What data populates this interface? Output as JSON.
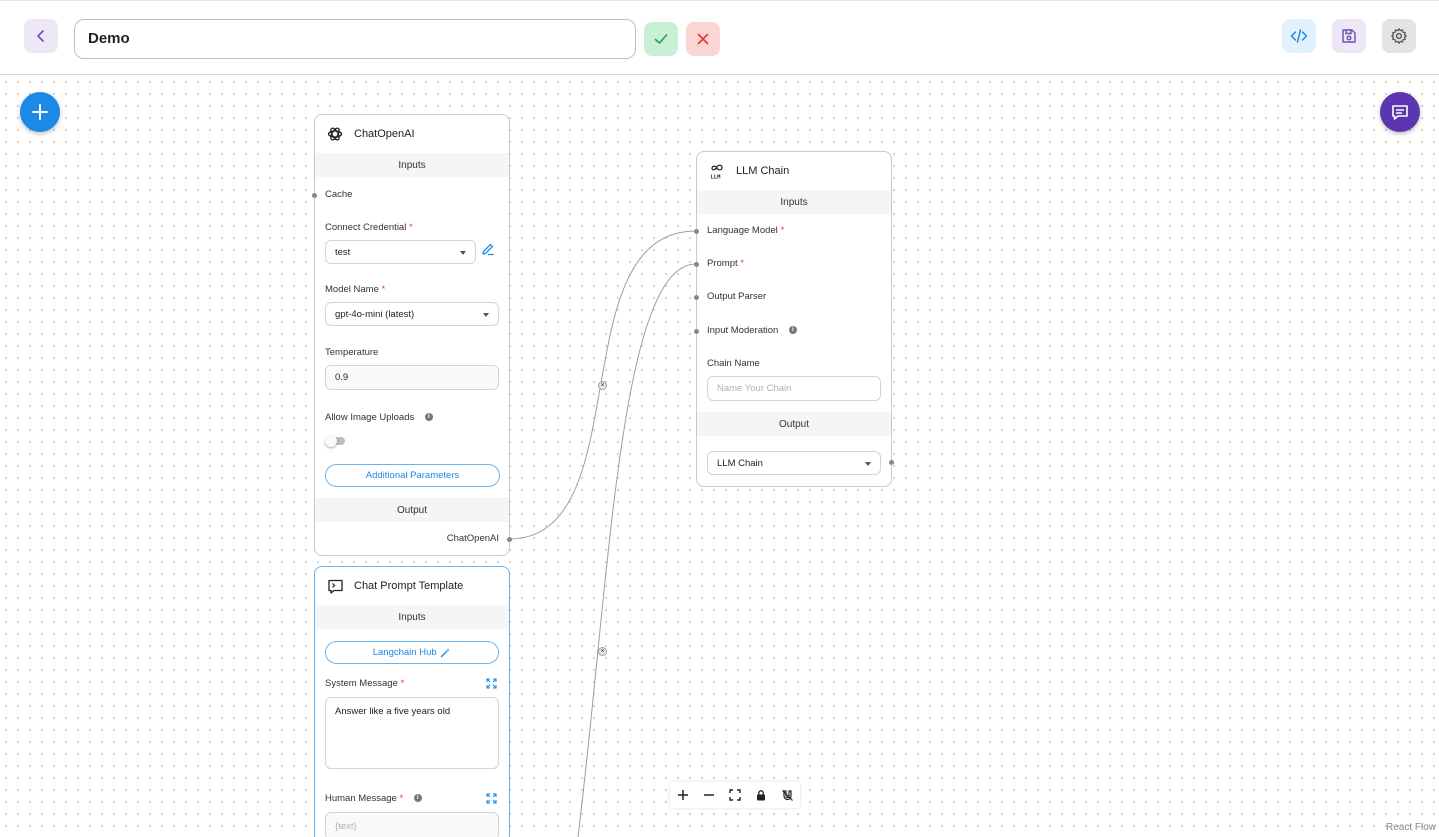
{
  "header": {
    "flow_name": "Demo"
  },
  "colors": {
    "primary_blue": "#1e88e5",
    "purple": "#5e35b1",
    "success_green": "#2e7d32",
    "danger_red": "#e53935"
  },
  "icons": {
    "back": "chevron-left-icon",
    "confirm": "check-icon",
    "cancel": "close-icon",
    "code": "code-icon",
    "save": "save-icon",
    "settings": "gear-icon",
    "add": "plus-icon",
    "chat": "chat-icon"
  },
  "nodes": {
    "chat_openai": {
      "title": "ChatOpenAI",
      "inputs_label": "Inputs",
      "cache_label": "Cache",
      "credential_label": "Connect Credential",
      "credential_value": "test",
      "model_label": "Model Name",
      "model_value": "gpt-4o-mini (latest)",
      "temperature_label": "Temperature",
      "temperature_value": "0.9",
      "image_uploads_label": "Allow Image Uploads",
      "additional_params_label": "Additional Parameters",
      "output_label": "Output",
      "output_value": "ChatOpenAI"
    },
    "chat_prompt": {
      "title": "Chat Prompt Template",
      "inputs_label": "Inputs",
      "hub_label": "Langchain Hub",
      "system_label": "System Message",
      "system_value": "Answer like a five years old",
      "human_label": "Human Message",
      "human_placeholder": "{text}"
    },
    "llm_chain": {
      "title": "LLM Chain",
      "inputs_label": "Inputs",
      "language_model_label": "Language Model",
      "prompt_label": "Prompt",
      "output_parser_label": "Output Parser",
      "input_moderation_label": "Input Moderation",
      "chain_name_label": "Chain Name",
      "chain_name_placeholder": "Name Your Chain",
      "output_label": "Output",
      "output_value": "LLM Chain"
    }
  },
  "required_mark": "*",
  "info_mark": "i",
  "edge_delete_mark": "×",
  "attribution": "React Flow"
}
